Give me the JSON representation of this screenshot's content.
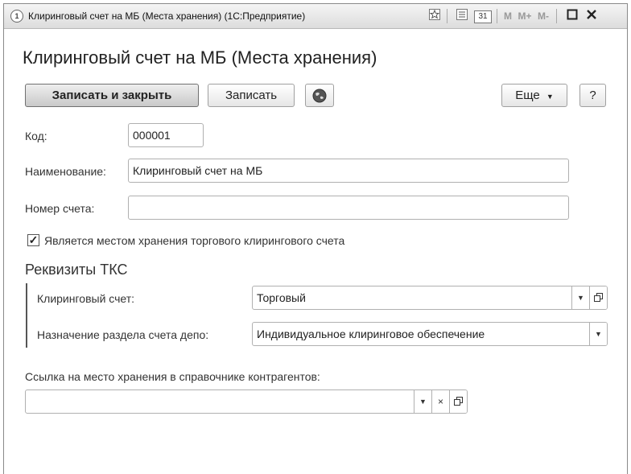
{
  "window": {
    "title": "Клиринговый счет на МБ (Места хранения)  (1С:Предприятие)",
    "icons": {
      "app": "1c-logo-icon",
      "favorite": "star-icon",
      "list": "list-icon",
      "calendar": "calendar-icon"
    },
    "calendar_text": "31",
    "m_label": "M",
    "mplus_label": "M+",
    "mminus_label": "M-"
  },
  "form": {
    "title": "Клиринговый счет на МБ (Места хранения)"
  },
  "toolbar": {
    "save_close_label": "Записать и закрыть",
    "save_label": "Записать",
    "more_label": "Еще",
    "help_label": "?",
    "globe_icon": "globe-icon"
  },
  "fields": {
    "code_label": "Код:",
    "code_value": "000001",
    "name_label": "Наименование:",
    "name_value": "Клиринговый счет на МБ",
    "account_label": "Номер счета:",
    "account_value": ""
  },
  "checkbox": {
    "checked": true,
    "label": "Является местом хранения торгового клирингового счета"
  },
  "group": {
    "title": "Реквизиты ТКС",
    "clearing_label": "Клиринговый счет:",
    "clearing_value": "Торговый",
    "purpose_label": "Назначение раздела счета депо:",
    "purpose_value": "Индивидуальное клиринговое обеспечение"
  },
  "link": {
    "label": "Ссылка на место хранения в справочнике контрагентов:",
    "value": ""
  }
}
